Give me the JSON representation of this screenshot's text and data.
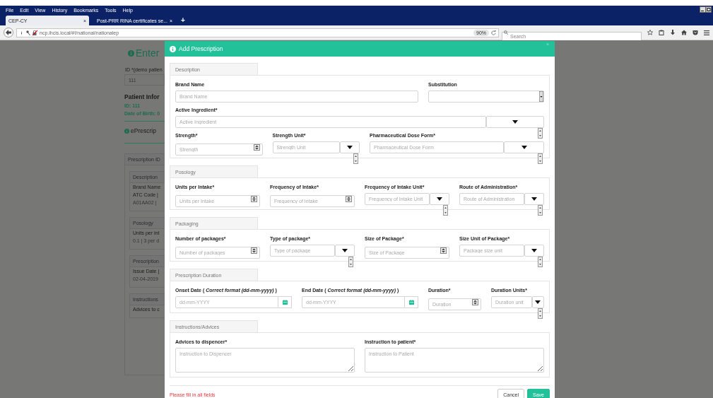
{
  "browser": {
    "menu": [
      "File",
      "Edit",
      "View",
      "History",
      "Bookmarks",
      "Tools",
      "Help"
    ],
    "tabs": [
      {
        "title": "CEP-CY",
        "selected": true,
        "close": "×"
      },
      {
        "title": "Post-PRR RINA certificates se...",
        "selected": false,
        "close": "×"
      }
    ],
    "new_tab": "+",
    "url": "ncp.ihcis.local/#!/national/nationalep",
    "zoom": "90%",
    "search": {
      "placeholder": "Search"
    }
  },
  "page": {
    "heading": "Enter",
    "id_label": "ID *(demo patien",
    "id_value": "111",
    "patient_heading": "Patient Infor",
    "patient_fields": [
      "ID: 111",
      "Date of Birth: 0"
    ],
    "section_heading": "ePrescrip",
    "panel_header": "Prescription ID",
    "cards": [
      {
        "header": "Description",
        "lines": [
          {
            "text": "Brand Name",
            "kind": "label"
          },
          {
            "text": "ATC Code |",
            "kind": "label"
          },
          {
            "text": "A01AA02 |",
            "kind": "value"
          }
        ]
      },
      {
        "header": "Posology",
        "lines": [
          {
            "text": "Units per int",
            "kind": "label"
          },
          {
            "text": "0.1 | 3 per d",
            "kind": "value"
          }
        ]
      },
      {
        "header": "Prescription",
        "lines": [
          {
            "text": "Issue Date |",
            "kind": "label"
          },
          {
            "text": "02-04-2019",
            "kind": "value"
          }
        ]
      },
      {
        "header": "Instructions",
        "lines": [
          {
            "text": "Advices to c",
            "kind": "label"
          }
        ]
      }
    ]
  },
  "modal": {
    "title": "Add Prescription",
    "close": "×",
    "sections": [
      {
        "title": "Description",
        "rows": [
          [
            {
              "label": "Brand Name",
              "kind": "text",
              "placeholder": "Brand Name"
            },
            {
              "label": "Substitution",
              "kind": "select"
            }
          ],
          [
            {
              "label": "Active Ingredient*",
              "kind": "combo",
              "placeholder": "Active Ingredient"
            }
          ],
          [
            {
              "label": "Strength*",
              "kind": "number",
              "placeholder": "Strength"
            },
            {
              "label": "Strength Unit*",
              "kind": "combo",
              "placeholder": "Strength Unit"
            },
            {
              "label": "Pharmaceutical Dose Form*",
              "kind": "combo",
              "placeholder": "Pharmaceutical Dose Form"
            }
          ]
        ]
      },
      {
        "title": "Posology",
        "rows": [
          [
            {
              "label": "Units per Intake*",
              "kind": "number",
              "placeholder": "Units per Intake"
            },
            {
              "label": "Frequency of Intake*",
              "kind": "number",
              "placeholder": "Frequency of Intake"
            },
            {
              "label": "Frequency of Intake Unit*",
              "kind": "combo",
              "placeholder": "Frequency of Intake Unit"
            },
            {
              "label": "Route of Administration*",
              "kind": "combo",
              "placeholder": "Route of Administration"
            }
          ]
        ]
      },
      {
        "title": "Packaging",
        "rows": [
          [
            {
              "label": "Number of packages*",
              "kind": "number",
              "placeholder": "Number of packages"
            },
            {
              "label": "Type of package*",
              "kind": "combo",
              "placeholder": "Type of package"
            },
            {
              "label": "Size of Package*",
              "kind": "number",
              "placeholder": "Size of Package"
            },
            {
              "label": "Size Unit of Package*",
              "kind": "combo",
              "placeholder": "Package size unit"
            }
          ]
        ]
      },
      {
        "title": "Prescription Duration",
        "rows": [
          [
            {
              "label": "Onset Date ( *Correct format (dd-mm-yyyy)* )",
              "kind": "date",
              "placeholder": "dd-mm-YYYY"
            },
            {
              "label": "End Date ( *Correct format (dd-mm-yyyy)* )",
              "kind": "date",
              "placeholder": "dd-mm-YYYY"
            },
            {
              "label": "Duration*",
              "kind": "number",
              "placeholder": "Duration"
            },
            {
              "label": "Duration Units*",
              "kind": "combo",
              "placeholder": "Duration unit"
            }
          ]
        ]
      },
      {
        "title": "Instructions/Advices",
        "rows": [
          [
            {
              "label": "Advices to dispencer*",
              "kind": "textarea",
              "placeholder": "Instruction to Dispencer"
            },
            {
              "label": "Instruction to patient*",
              "kind": "textarea",
              "placeholder": "Instruction to Patient"
            }
          ]
        ]
      }
    ],
    "error": "Please fill in all fields",
    "buttons": [
      {
        "label": "Cancel",
        "kind": "secondary"
      },
      {
        "label": "Save",
        "kind": "primary"
      }
    ]
  }
}
